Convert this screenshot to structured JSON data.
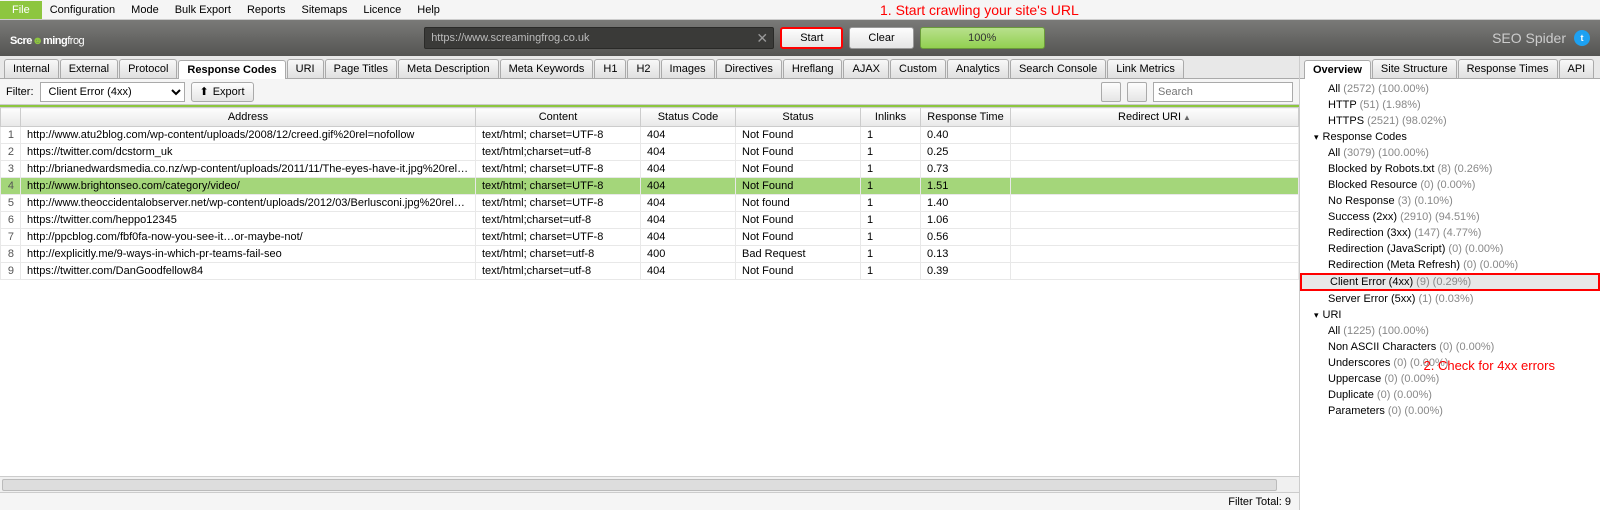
{
  "menu": [
    "File",
    "Configuration",
    "Mode",
    "Bulk Export",
    "Reports",
    "Sitemaps",
    "Licence",
    "Help"
  ],
  "annotation1": "1. Start crawling your site's URL",
  "annotation2": "2. Check for 4xx errors",
  "header": {
    "logo_left": "Scre",
    "logo_right": "ming",
    "logo_frog": "frog",
    "url": "https://www.screamingfrog.co.uk",
    "start": "Start",
    "clear": "Clear",
    "progress": "100%",
    "spider": "SEO Spider"
  },
  "tabs_left": [
    "Internal",
    "External",
    "Protocol",
    "Response Codes",
    "URI",
    "Page Titles",
    "Meta Description",
    "Meta Keywords",
    "H1",
    "H2",
    "Images",
    "Directives",
    "Hreflang",
    "AJAX",
    "Custom",
    "Analytics",
    "Search Console",
    "Link Metrics"
  ],
  "tabs_left_active": 3,
  "filter": {
    "label": "Filter:",
    "value": "Client Error (4xx)",
    "export": "Export",
    "search_ph": "Search"
  },
  "columns": [
    "",
    "Address",
    "Content",
    "Status Code",
    "Status",
    "Inlinks",
    "Response Time",
    "Redirect URI"
  ],
  "rows": [
    {
      "n": "1",
      "addr": "http://www.atu2blog.com/wp-content/uploads/2008/12/creed.gif%20rel=nofollow",
      "ct": "text/html; charset=UTF-8",
      "sc": "404",
      "st": "Not Found",
      "in": "1",
      "rt": "0.40"
    },
    {
      "n": "2",
      "addr": "https://twitter.com/dcstorm_uk",
      "ct": "text/html;charset=utf-8",
      "sc": "404",
      "st": "Not Found",
      "in": "1",
      "rt": "0.25"
    },
    {
      "n": "3",
      "addr": "http://brianedwardsmedia.co.nz/wp-content/uploads/2011/11/The-eyes-have-it.jpg%20rel=...",
      "ct": "text/html; charset=UTF-8",
      "sc": "404",
      "st": "Not Found",
      "in": "1",
      "rt": "0.73"
    },
    {
      "n": "4",
      "addr": "http://www.brightonseo.com/category/video/",
      "ct": "text/html; charset=UTF-8",
      "sc": "404",
      "st": "Not Found",
      "in": "1",
      "rt": "1.51",
      "sel": true
    },
    {
      "n": "5",
      "addr": "http://www.theoccidentalobserver.net/wp-content/uploads/2012/03/Berlusconi.jpg%20rel=n...",
      "ct": "text/html; charset=UTF-8",
      "sc": "404",
      "st": "Not found",
      "in": "1",
      "rt": "1.40"
    },
    {
      "n": "6",
      "addr": "https://twitter.com/heppo12345",
      "ct": "text/html;charset=utf-8",
      "sc": "404",
      "st": "Not Found",
      "in": "1",
      "rt": "1.06"
    },
    {
      "n": "7",
      "addr": "http://ppcblog.com/fbf0fa-now-you-see-it…or-maybe-not/",
      "ct": "text/html; charset=UTF-8",
      "sc": "404",
      "st": "Not Found",
      "in": "1",
      "rt": "0.56"
    },
    {
      "n": "8",
      "addr": "http://explicitly.me/9-ways-in-which-pr-teams-fail-seo",
      "ct": "text/html; charset=utf-8",
      "sc": "400",
      "st": "Bad Request",
      "in": "1",
      "rt": "0.13"
    },
    {
      "n": "9",
      "addr": "https://twitter.com/DanGoodfellow84",
      "ct": "text/html;charset=utf-8",
      "sc": "404",
      "st": "Not Found",
      "in": "1",
      "rt": "0.39"
    }
  ],
  "statusbar": {
    "filter_total": "Filter Total:  9"
  },
  "tabs_right": [
    "Overview",
    "Site Structure",
    "Response Times",
    "API"
  ],
  "tabs_right_active": 0,
  "tree": [
    {
      "t": "item",
      "label": "All",
      "count": "(2572) (100.00%)"
    },
    {
      "t": "item",
      "label": "HTTP",
      "count": "(51) (1.98%)"
    },
    {
      "t": "item",
      "label": "HTTPS",
      "count": "(2521) (98.02%)"
    },
    {
      "t": "hdr",
      "label": "Response Codes"
    },
    {
      "t": "item",
      "label": "All",
      "count": "(3079) (100.00%)"
    },
    {
      "t": "item",
      "label": "Blocked by Robots.txt",
      "count": "(8) (0.26%)"
    },
    {
      "t": "item",
      "label": "Blocked Resource",
      "count": "(0) (0.00%)"
    },
    {
      "t": "item",
      "label": "No Response",
      "count": "(3) (0.10%)"
    },
    {
      "t": "item",
      "label": "Success (2xx)",
      "count": "(2910) (94.51%)"
    },
    {
      "t": "item",
      "label": "Redirection (3xx)",
      "count": "(147) (4.77%)"
    },
    {
      "t": "item",
      "label": "Redirection (JavaScript)",
      "count": "(0) (0.00%)"
    },
    {
      "t": "item",
      "label": "Redirection (Meta Refresh)",
      "count": "(0) (0.00%)"
    },
    {
      "t": "item",
      "label": "Client Error (4xx)",
      "count": "(9) (0.29%)",
      "sel": true
    },
    {
      "t": "item",
      "label": "Server Error (5xx)",
      "count": "(1) (0.03%)"
    },
    {
      "t": "hdr",
      "label": "URI"
    },
    {
      "t": "item",
      "label": "All",
      "count": "(1225) (100.00%)"
    },
    {
      "t": "item",
      "label": "Non ASCII Characters",
      "count": "(0) (0.00%)"
    },
    {
      "t": "item",
      "label": "Underscores",
      "count": "(0) (0.00%)"
    },
    {
      "t": "item",
      "label": "Uppercase",
      "count": "(0) (0.00%)"
    },
    {
      "t": "item",
      "label": "Duplicate",
      "count": "(0) (0.00%)"
    },
    {
      "t": "item",
      "label": "Parameters",
      "count": "(0) (0.00%)"
    }
  ]
}
